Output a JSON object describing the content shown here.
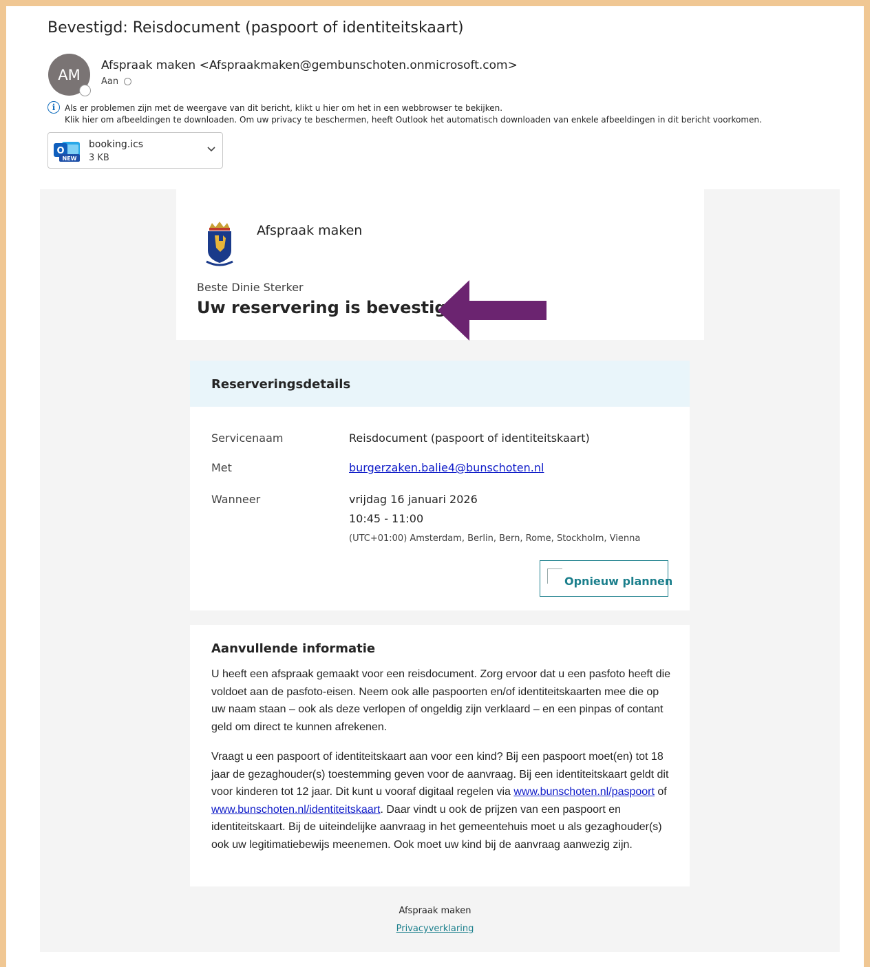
{
  "email": {
    "subject": "Bevestigd: Reisdocument (paspoort of identiteitskaart)",
    "avatar_initials": "AM",
    "sender": "Afspraak maken <Afspraakmaken@gembunschoten.onmicrosoft.com>",
    "to_label": "Aan",
    "info_line1": "Als er problemen zijn met de weergave van dit bericht, klikt u hier om het in een webbrowser te bekijken.",
    "info_line2": "Klik hier om afbeeldingen te downloaden. Om uw privacy te beschermen, heeft Outlook het automatisch downloaden van enkele afbeeldingen in dit bericht voorkomen.",
    "attachment": {
      "name": "booking.ics",
      "size": "3 KB",
      "icon_badge": "NEW",
      "icon_letter": "O"
    }
  },
  "body": {
    "brand": "Afspraak maken",
    "greeting": "Beste Dinie Sterker",
    "headline": "Uw reservering is bevestigd.",
    "details": {
      "title": "Reserveringsdetails",
      "service_label": "Servicenaam",
      "service_value": "Reisdocument (paspoort of identiteitskaart)",
      "with_label": "Met",
      "with_value": "burgerzaken.balie4@bunschoten.nl",
      "when_label": "Wanneer",
      "when_date": "vrijdag 16 januari 2026",
      "when_time": "10:45 - 11:00",
      "when_timezone": "(UTC+01:00) Amsterdam, Berlin, Bern, Rome, Stockholm, Vienna",
      "reschedule_label": "Opnieuw plannen"
    },
    "additional": {
      "title": "Aanvullende informatie",
      "para1": "U heeft een afspraak gemaakt voor een reisdocument. Zorg ervoor dat u een pasfoto heeft die voldoet aan de pasfoto-eisen. Neem ook alle paspoorten en/of identiteitskaarten mee die op uw naam staan – ook als deze verlopen of ongeldig zijn verklaard – en een pinpas of contant geld om direct te kunnen afrekenen.",
      "para2_before": "Vraagt u een paspoort of identiteitskaart aan voor een kind? Bij een paspoort moet(en) tot 18 jaar de gezaghouder(s) toestemming geven voor de aanvraag. Bij een identiteitskaart geldt dit voor kinderen tot 12 jaar. Dit kunt u vooraf digitaal regelen via ",
      "link1": "www.bunschoten.nl/paspoort",
      "para2_mid": " of ",
      "link2": "www.bunschoten.nl/identiteitskaart",
      "para2_after": ". Daar vindt u ook de prijzen van een paspoort en identiteitskaart. Bij de uiteindelijke aanvraag in het gemeentehuis moet u als gezaghouder(s) ook uw legitimatiebewijs meenemen. Ook moet uw kind bij de aanvraag aanwezig zijn."
    },
    "footer": {
      "name": "Afspraak maken",
      "privacy": "Privacyverklaring"
    }
  },
  "colors": {
    "frame": "#f0c793",
    "arrow": "#6b2470",
    "accent": "#1b7f8c",
    "header_bg": "#e9f5fa"
  }
}
